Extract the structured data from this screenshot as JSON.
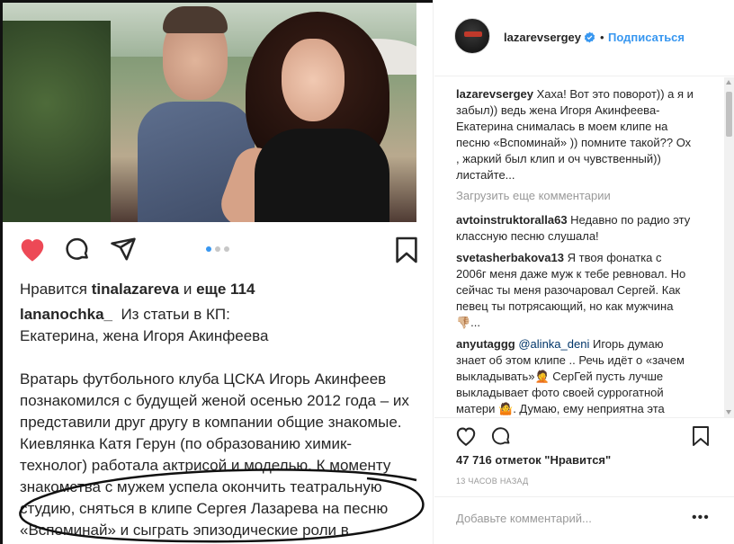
{
  "left_post": {
    "likes_prefix": "Нравится",
    "likes_user": "tinalazareva",
    "likes_and": "и",
    "likes_more": "еще 114",
    "caption_user": "lananochka_",
    "caption_line1": "Из статьи  в КП:",
    "caption_line2": "Екатерина, жена Игоря Акинфеева",
    "caption_body": "Вратарь футбольного клуба ЦСКА Игорь Акинфеев познакомился с будущей женой осенью 2012 года – их представили друг другу в компании общие знакомые. Киевлянка Катя Герун (по образованию химик-технолог) работала актрисой и моделью. К моменту знакомства с мужем успела окончить театральную студию, сняться в клипе Сергея Лазарева на песню «Вспоминай» и сыграть эпизодические роли в нескольких фильмах."
  },
  "header": {
    "username": "lazarevsergey",
    "separator": "•",
    "follow_label": "Подписаться"
  },
  "comments": {
    "main": {
      "user": "lazarevsergey",
      "text": "Хаха! Вот это поворот)) а я и забыл)) ведь жена Игоря Акинфеева-Екатерина снималась в моем клипе на песню «Вспоминай» )) помните такой?? Ох , жаркий был клип и оч чувственный)) листайте..."
    },
    "load_more": "Загрузить еще комментарии",
    "items": [
      {
        "user": "avtoinstruktoralla63",
        "text": "Недавно по радио эту классную песню слушала!"
      },
      {
        "user": "svetasherbakova13",
        "text": "Я твоя фонатка с 2006г меня даже муж к тебе ревновал. Но сейчас ты меня разочаровал Сергей. Как певец ты потрясающий, но как мужчина 👎🏼..."
      },
      {
        "user": "anyutaggg",
        "mention": "@alinka_deni",
        "text": "Игорь думаю знает об этом клипе .. Речь идёт о «зачем выкладывать»🤦 СерГей пусть лучше выкладывает фото своей суррогатной матери 🤷. Думаю, ему неприятна эта"
      }
    ]
  },
  "footer": {
    "likes": "47 716 отметок \"Нравится\"",
    "time": "13 часов назад",
    "add_comment_placeholder": "Добавьте комментарий...",
    "more_label": "•••"
  },
  "colors": {
    "accent": "#3897f0",
    "heart": "#ed4956",
    "muted": "#999999",
    "text": "#262626"
  },
  "icons": [
    "heart-filled-icon",
    "comment-icon",
    "share-icon",
    "bookmark-icon",
    "verified-icon",
    "heart-outline-icon"
  ]
}
